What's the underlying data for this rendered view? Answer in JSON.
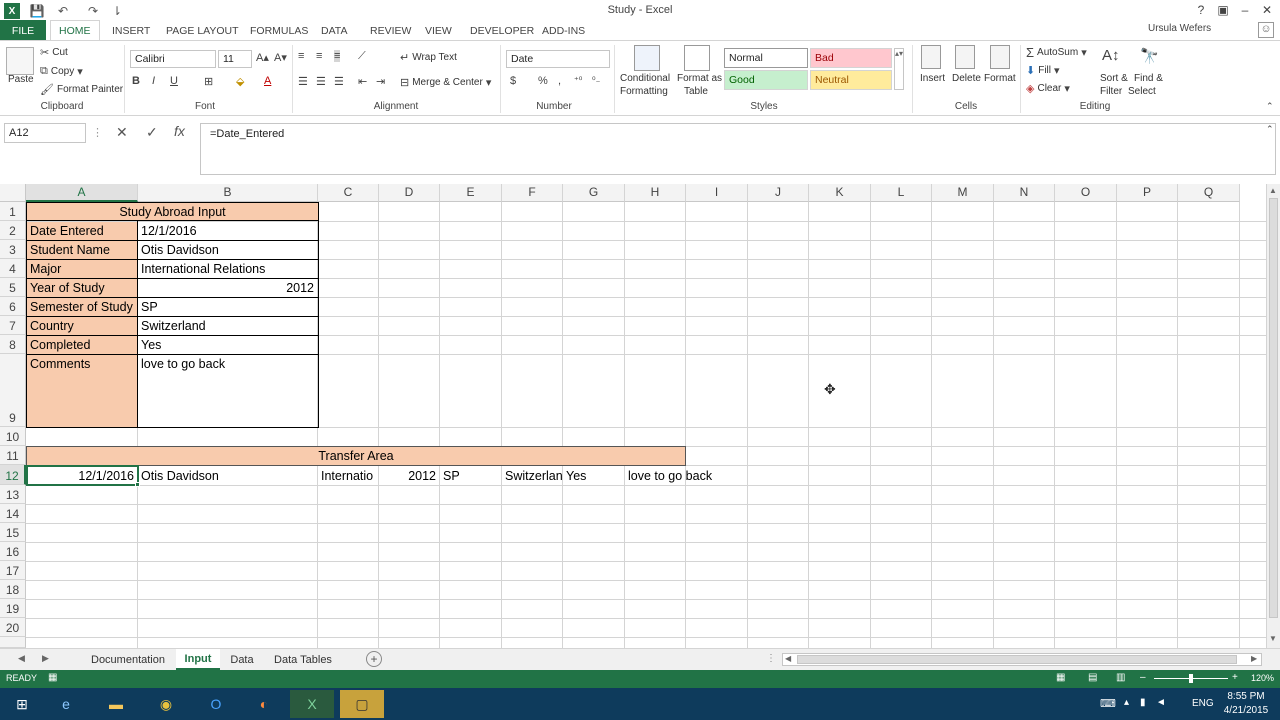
{
  "window": {
    "title": "Study - Excel",
    "user": "Ursula Wefers"
  },
  "ribbon_tabs": [
    "FILE",
    "HOME",
    "INSERT",
    "PAGE LAYOUT",
    "FORMULAS",
    "DATA",
    "REVIEW",
    "VIEW",
    "DEVELOPER",
    "ADD-INS"
  ],
  "clipboard": {
    "paste": "Paste",
    "cut": "Cut",
    "copy": "Copy",
    "format_painter": "Format Painter",
    "label": "Clipboard"
  },
  "font": {
    "name": "Calibri",
    "size": "11",
    "bold": "B",
    "italic": "I",
    "underline": "U",
    "label": "Font"
  },
  "alignment": {
    "wrap": "Wrap Text",
    "merge": "Merge & Center",
    "label": "Alignment"
  },
  "number": {
    "format": "Date",
    "currency": "$",
    "percent": "%",
    "comma": ",",
    "label": "Number"
  },
  "styles": {
    "cond": "Conditional Formatting",
    "cond1": "Conditional",
    "cond2": "Formatting",
    "fmt1": "Format as",
    "fmt2": "Table",
    "normal": "Normal",
    "bad": "Bad",
    "good": "Good",
    "neutral": "Neutral",
    "label": "Styles"
  },
  "cells": {
    "insert": "Insert",
    "delete": "Delete",
    "format": "Format",
    "label": "Cells"
  },
  "editing": {
    "autosum": "AutoSum",
    "fill": "Fill",
    "clear": "Clear",
    "sort1": "Sort &",
    "sort2": "Filter",
    "find1": "Find &",
    "find2": "Select",
    "label": "Editing"
  },
  "formula_bar": {
    "name_box": "A12",
    "formula": "=Date_Entered"
  },
  "columns": [
    "A",
    "B",
    "C",
    "D",
    "E",
    "F",
    "G",
    "H",
    "I",
    "J",
    "K",
    "L",
    "M",
    "N",
    "O",
    "P",
    "Q"
  ],
  "rows": [
    "1",
    "2",
    "3",
    "4",
    "5",
    "6",
    "7",
    "8",
    "9",
    "10",
    "11",
    "12",
    "13",
    "14",
    "15",
    "16",
    "17",
    "18",
    "19",
    "20"
  ],
  "sheet": {
    "title": "Study Abroad Input",
    "labels": [
      "Date Entered",
      "Student Name",
      "Major",
      "Year of Study",
      "Semester of Study",
      "Country",
      "Completed",
      "Comments"
    ],
    "values": [
      "12/1/2016",
      "Otis Davidson",
      "International Relations",
      "2012",
      "SP",
      "Switzerland",
      "Yes",
      "love to go back"
    ],
    "transfer_title": "Transfer Area",
    "transfer_row": [
      "12/1/2016",
      "Otis Davidson",
      "Internatio",
      "2012",
      "SP",
      "Switzerlan",
      "Yes",
      "love to go back"
    ]
  },
  "sheet_tabs": [
    "Documentation",
    "Input",
    "Data",
    "Data Tables"
  ],
  "status": {
    "mode": "READY",
    "zoom": "120%"
  },
  "taskbar": {
    "lang": "ENG",
    "time": "8:55 PM",
    "date": "4/21/2015"
  },
  "colors": {
    "accent": "#217346",
    "orange": "#f8cbad",
    "bad": "#ffc7ce",
    "good": "#c6efce",
    "neutral": "#ffeb9c"
  }
}
